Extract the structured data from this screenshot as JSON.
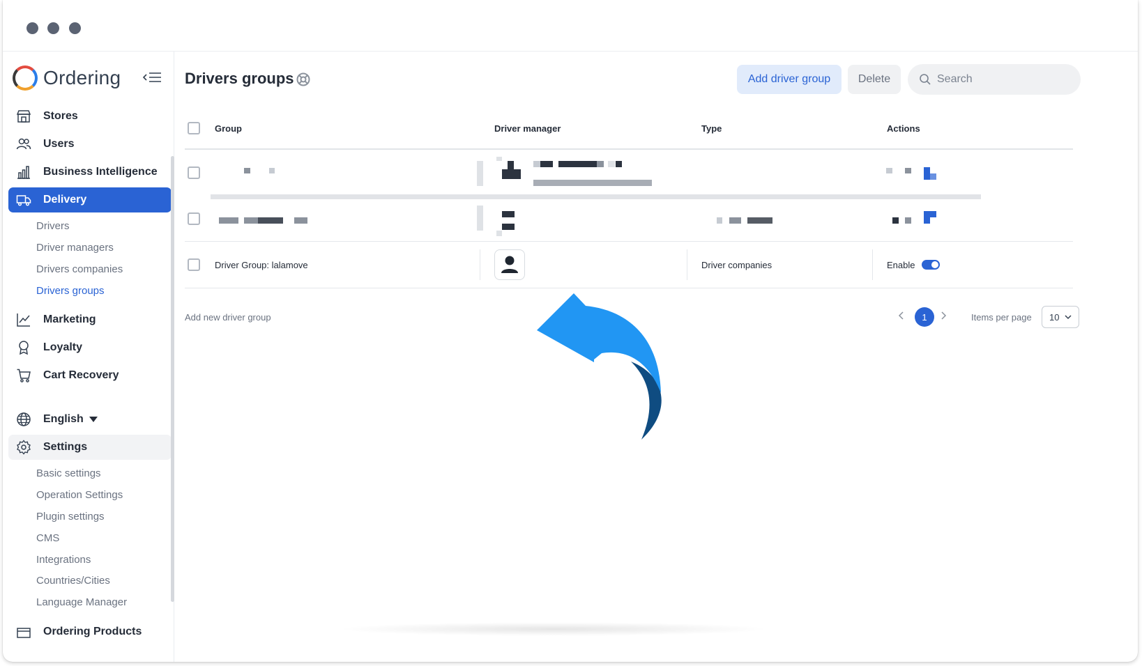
{
  "window": {
    "controls": [
      "close",
      "minimize",
      "maximize"
    ]
  },
  "brand": {
    "name": "Ordering"
  },
  "sidebar": {
    "items": [
      {
        "label": "Stores",
        "icon": "store-icon"
      },
      {
        "label": "Users",
        "icon": "users-icon"
      },
      {
        "label": "Business Intelligence",
        "icon": "bar-chart-icon"
      },
      {
        "label": "Delivery",
        "icon": "truck-icon",
        "active": true
      },
      {
        "label": "Marketing",
        "icon": "line-chart-icon"
      },
      {
        "label": "Loyalty",
        "icon": "award-icon"
      },
      {
        "label": "Cart Recovery",
        "icon": "cart-icon"
      },
      {
        "label": "English",
        "icon": "globe-icon"
      },
      {
        "label": "Settings",
        "icon": "gear-icon"
      },
      {
        "label": "Ordering Products",
        "icon": "box-icon"
      }
    ],
    "delivery_sub": [
      "Drivers",
      "Driver managers",
      "Drivers companies",
      "Drivers groups"
    ],
    "settings_sub": [
      "Basic settings",
      "Operation Settings",
      "Plugin settings",
      "CMS",
      "Integrations",
      "Countries/Cities",
      "Language Manager"
    ]
  },
  "header": {
    "title": "Drivers groups",
    "add_label": "Add driver group",
    "delete_label": "Delete",
    "search_placeholder": "Search"
  },
  "table": {
    "columns": [
      "Group",
      "Driver manager",
      "Type",
      "Actions"
    ],
    "rows": [
      {
        "group": "Driver Group: lalamove",
        "type": "Driver companies",
        "action_label": "Enable",
        "enabled": true
      }
    ]
  },
  "footer": {
    "add_new": "Add new driver group",
    "current_page": "1",
    "items_per_page_label": "Items per page",
    "items_per_page_value": "10"
  },
  "colors": {
    "accent": "#2a63d4",
    "arrow": "#2196f3",
    "arrow_dark": "#0f4c81"
  }
}
